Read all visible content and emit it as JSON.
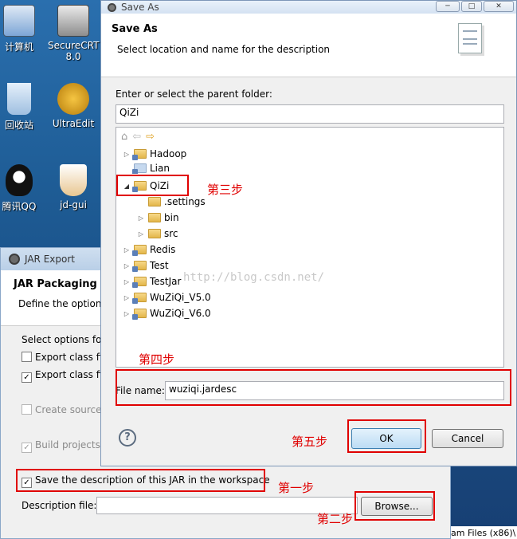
{
  "desktop": {
    "icons": [
      {
        "label": "计算机",
        "name": "computer-icon"
      },
      {
        "label": "SecureCRT 8.0",
        "name": "securecrt-icon"
      },
      {
        "label": "回收站",
        "name": "recycle-bin-icon"
      },
      {
        "label": "UltraEdit",
        "name": "ultraedit-icon"
      },
      {
        "label": "腾讯QQ",
        "name": "qq-icon"
      },
      {
        "label": "jd-gui",
        "name": "jd-gui-icon"
      }
    ],
    "bottom_text": "am Files (x86)\\"
  },
  "jar_export": {
    "title": "JAR Export",
    "header_title": "JAR Packaging Op",
    "header_subtitle": "Define the option",
    "select_options": "Select options for",
    "export_class_1": "Export class fil",
    "export_class_2": "Export class fil",
    "create_source": "Create source",
    "build_projects": "Build projects",
    "save_description": "Save the description of this JAR in the workspace",
    "description_file_label": "Description file:",
    "description_file_value": "",
    "browse_label": "Browse..."
  },
  "save_as": {
    "title": "Save As",
    "header_title": "Save As",
    "header_subtitle": "Select location and name for the description",
    "parent_folder_label": "Enter or select the parent folder:",
    "parent_folder_value": "QiZi",
    "tree": [
      {
        "label": "Hadoop",
        "expanded": false
      },
      {
        "label": "Lian",
        "expanded": false
      },
      {
        "label": "QiZi",
        "expanded": true
      },
      {
        "label": ".settings",
        "expanded": false
      },
      {
        "label": "bin",
        "expanded": false
      },
      {
        "label": "src",
        "expanded": false
      },
      {
        "label": "Redis",
        "expanded": false
      },
      {
        "label": "Test",
        "expanded": false
      },
      {
        "label": "TestJar",
        "expanded": false
      },
      {
        "label": "WuZiQi_V5.0",
        "expanded": false
      },
      {
        "label": "WuZiQi_V6.0",
        "expanded": false
      }
    ],
    "file_name_label": "File name:",
    "file_name_value": "wuziqi.jardesc",
    "ok_label": "OK",
    "cancel_label": "Cancel",
    "help_icon": "?",
    "watermark": "http://blog.csdn.net/"
  },
  "annotations": {
    "step1": "第一步",
    "step2": "第二步",
    "step3": "第三步",
    "step4": "第四步",
    "step5": "第五步"
  },
  "colors": {
    "highlight_red": "#e00000",
    "ok_button_blue": "#c7e2f7"
  }
}
